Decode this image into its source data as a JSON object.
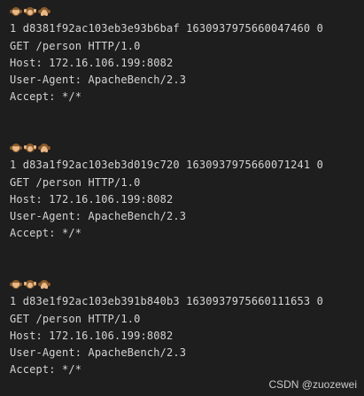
{
  "terminal": {
    "blocks": [
      {
        "emoji_icons": [
          "see-no-evil-monkey-icon",
          "hear-no-evil-monkey-icon",
          "speak-no-evil-monkey-icon"
        ],
        "lines": [
          "1 d8381f92ac103eb3e93b6baf 1630937975660047460 0",
          "GET /person HTTP/1.0",
          "Host: 172.16.106.199:8082",
          "User-Agent: ApacheBench/2.3",
          "Accept: */*"
        ]
      },
      {
        "emoji_icons": [
          "see-no-evil-monkey-icon",
          "hear-no-evil-monkey-icon",
          "speak-no-evil-monkey-icon"
        ],
        "lines": [
          "1 d83a1f92ac103eb3d019c720 1630937975660071241 0",
          "GET /person HTTP/1.0",
          "Host: 172.16.106.199:8082",
          "User-Agent: ApacheBench/2.3",
          "Accept: */*"
        ]
      },
      {
        "emoji_icons": [
          "see-no-evil-monkey-icon",
          "hear-no-evil-monkey-icon",
          "speak-no-evil-monkey-icon"
        ],
        "lines": [
          "1 d83e1f92ac103eb391b840b3 1630937975660111653 0",
          "GET /person HTTP/1.0",
          "Host: 172.16.106.199:8082",
          "User-Agent: ApacheBench/2.3",
          "Accept: */*"
        ]
      }
    ]
  },
  "watermark": {
    "text": "CSDN @zuozewei"
  },
  "colors": {
    "background": "#1e1e1e",
    "text": "#d4d4d4"
  }
}
